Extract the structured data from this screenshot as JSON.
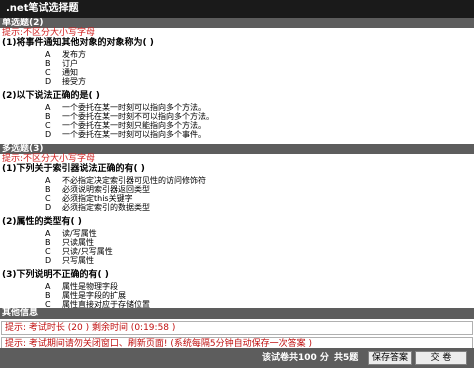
{
  "window": {
    "title": ".net笔试选择题"
  },
  "sections": [
    {
      "header": "单选题(2)",
      "hint": "提示:不区分大小写字母",
      "questions": [
        {
          "text": "(1)将事件通知其他对象的对象称为( )",
          "options": [
            {
              "letter": "A",
              "text": "发布方"
            },
            {
              "letter": "B",
              "text": "订户"
            },
            {
              "letter": "C",
              "text": "通知"
            },
            {
              "letter": "D",
              "text": "接受方"
            }
          ]
        },
        {
          "text": "(2)以下说法正确的是( )",
          "options": [
            {
              "letter": "A",
              "text": "一个委托在某一时刻可以指向多个方法。"
            },
            {
              "letter": "B",
              "text": "一个委托在某一时刻不可以指向多个方法。"
            },
            {
              "letter": "C",
              "text": "一个委托在某一时刻只能指向多个方法。"
            },
            {
              "letter": "D",
              "text": "一个委托在某一时刻可以指向多个事件。"
            }
          ]
        }
      ]
    },
    {
      "header": "多选题(3)",
      "hint": "提示:不区分大小写字母",
      "questions": [
        {
          "text": "(1)下列关于索引器说法正确的有( )",
          "options": [
            {
              "letter": "A",
              "text": "不必指定决定索引器可见性的访问修饰符"
            },
            {
              "letter": "B",
              "text": "必须说明索引器返回类型"
            },
            {
              "letter": "C",
              "text": "必须指定this关键字"
            },
            {
              "letter": "D",
              "text": "必须指定索引的数据类型"
            }
          ]
        },
        {
          "text": "(2)属性的类型有( )",
          "options": [
            {
              "letter": "A",
              "text": "读/写属性"
            },
            {
              "letter": "B",
              "text": "只读属性"
            },
            {
              "letter": "C",
              "text": "只读/只写属性"
            },
            {
              "letter": "D",
              "text": "只写属性"
            }
          ]
        },
        {
          "text": "(3)下列说明不正确的有( )",
          "options": [
            {
              "letter": "A",
              "text": "属性是物理字段"
            },
            {
              "letter": "B",
              "text": "属性是字段的扩展"
            },
            {
              "letter": "C",
              "text": "属性直接对应于存储位置"
            },
            {
              "letter": "D",
              "text": "属性是逻辑字段"
            }
          ]
        }
      ]
    }
  ],
  "status": {
    "header": "其他信息",
    "line1": "提示: 考试时长 (20 ) 剩余时间 (0:19:58 )",
    "line2": "提示: 考试期间请勿关闭窗口、刷新页面! (系统每隔5分钟自动保存一次答案 )"
  },
  "footer": {
    "total": "该试卷共100 分",
    "count": "共5题",
    "save_label": "保存答案",
    "submit_label": "交 卷"
  }
}
